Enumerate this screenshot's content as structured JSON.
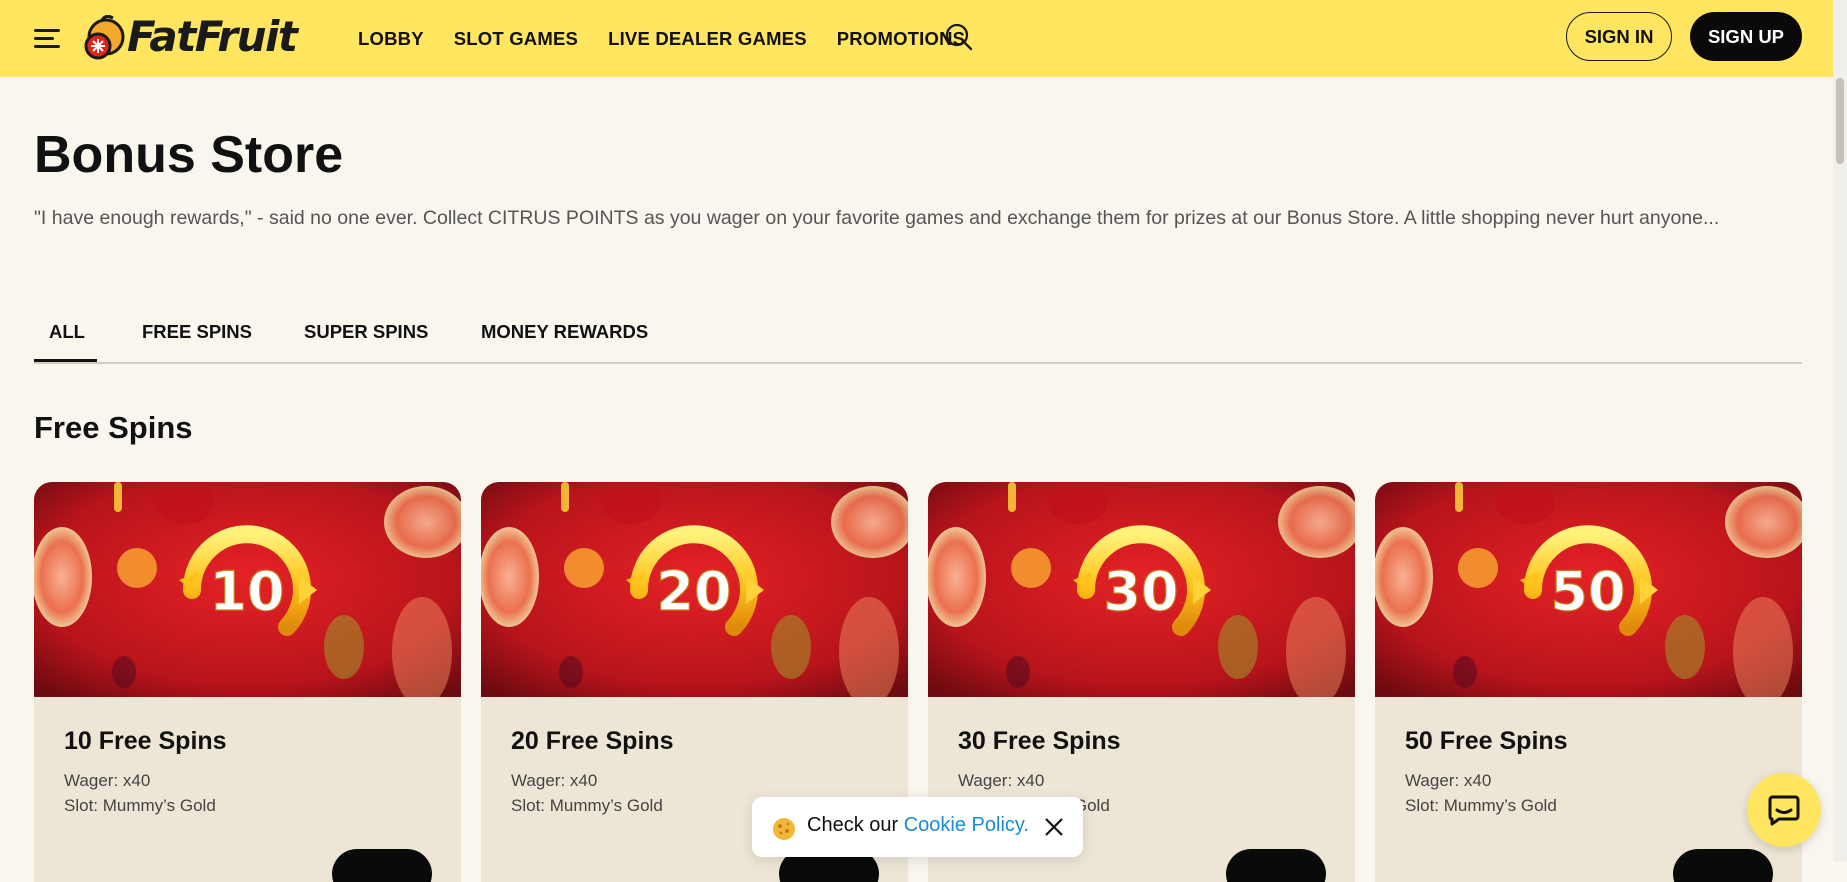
{
  "header": {
    "logo_text": "FatFruit",
    "nav": [
      "LOBBY",
      "SLOT GAMES",
      "LIVE DEALER GAMES",
      "PROMOTIONS"
    ],
    "sign_in": "SIGN IN",
    "sign_up": "SIGN UP"
  },
  "page": {
    "title": "Bonus Store",
    "description": "\"I have enough rewards,\" - said no one ever. Collect CITRUS POINTS as you wager on your favorite games and exchange them for prizes at our Bonus Store. A little shopping never hurt anyone..."
  },
  "tabs": [
    "ALL",
    "FREE SPINS",
    "SUPER SPINS",
    "MONEY REWARDS"
  ],
  "active_tab": "ALL",
  "section": {
    "title": "Free Spins"
  },
  "cards": [
    {
      "badge": "10",
      "title": "10 Free Spins",
      "wager": "Wager: x40",
      "slot": "Slot: Mummy’s Gold"
    },
    {
      "badge": "20",
      "title": "20 Free Spins",
      "wager": "Wager: x40",
      "slot": "Slot: Mummy’s Gold"
    },
    {
      "badge": "30",
      "title": "30 Free Spins",
      "wager": "Wager: x40",
      "slot": "Slot: Mummy’s Gold"
    },
    {
      "badge": "50",
      "title": "50 Free Spins",
      "wager": "Wager: x40",
      "slot": "Slot: Mummy’s Gold"
    }
  ],
  "cookie": {
    "text": "Check our ",
    "link": "Cookie Policy."
  },
  "colors": {
    "header_bg": "#ffe560",
    "page_bg": "#f9f6ee",
    "card_body_bg": "#ede6d6",
    "card_img_red": "#c8161d",
    "link": "#1a8bd6"
  },
  "icons": [
    "hamburger-menu-icon",
    "search-icon",
    "cookie-icon",
    "close-icon",
    "chat-icon"
  ]
}
